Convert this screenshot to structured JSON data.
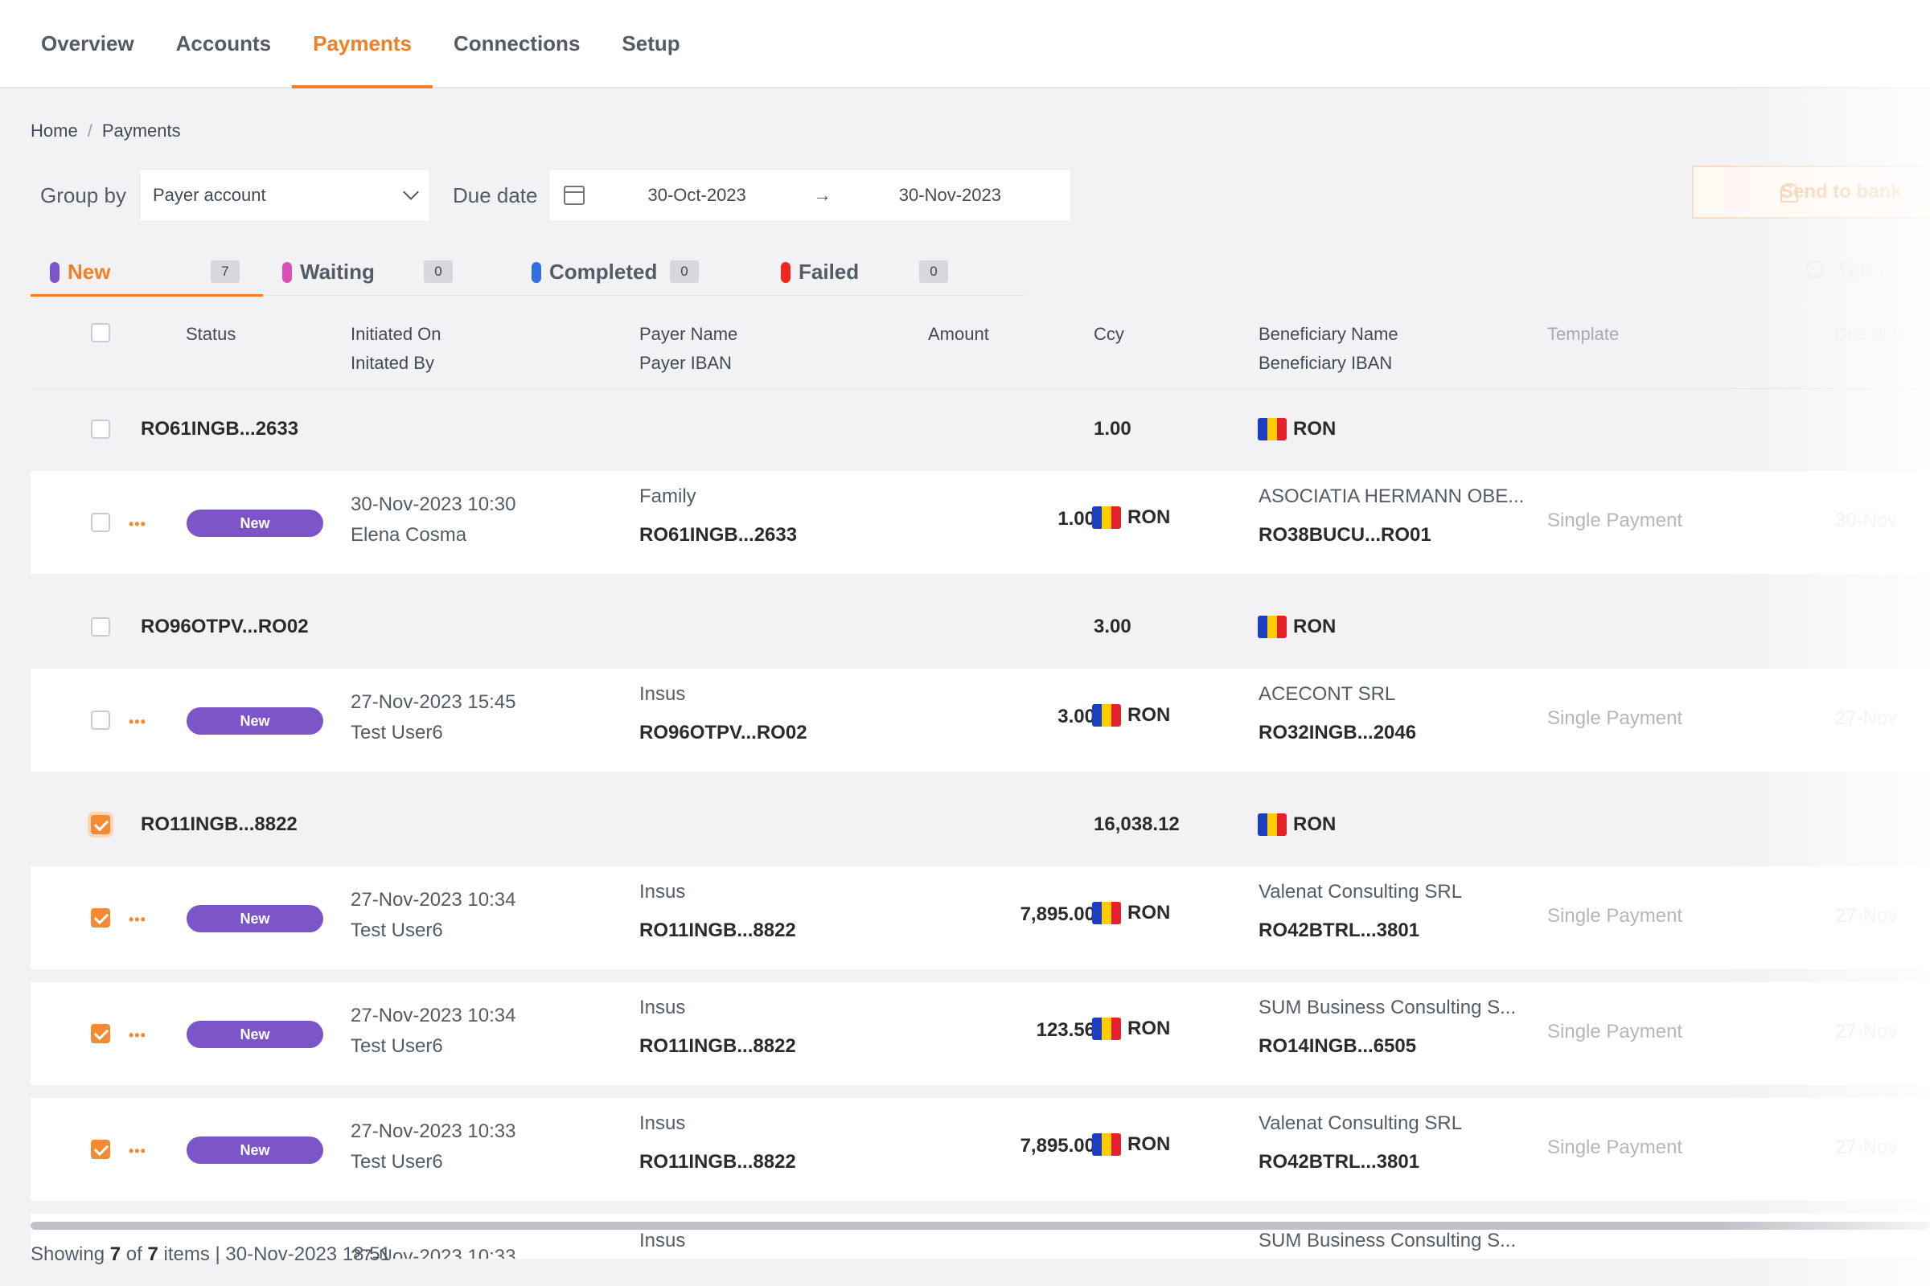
{
  "nav": {
    "tabs": [
      {
        "label": "Overview"
      },
      {
        "label": "Accounts"
      },
      {
        "label": "Payments"
      },
      {
        "label": "Connections"
      },
      {
        "label": "Setup"
      }
    ],
    "active": "Payments"
  },
  "breadcrumb": {
    "home": "Home",
    "sep": "/",
    "current": "Payments"
  },
  "filters": {
    "group_by_label": "Group by",
    "group_by_value": "Payer account",
    "due_date_label": "Due date",
    "date_from": "30-Oct-2023",
    "arrow": "→",
    "date_to": "30-Nov-2023"
  },
  "actions": {
    "send_label": "Send to bank"
  },
  "search": {
    "placeholder": "Type a"
  },
  "status_tabs": [
    {
      "label": "New",
      "count": "7",
      "color": "#7c55c9"
    },
    {
      "label": "Waiting",
      "count": "0",
      "color": "#d94fb2"
    },
    {
      "label": "Completed",
      "count": "0",
      "color": "#2f6fdf"
    },
    {
      "label": "Failed",
      "count": "0",
      "color": "#f0271c"
    }
  ],
  "table": {
    "headers": {
      "status": "Status",
      "initiated_on": "Initiated On",
      "initiated_by": "Initated By",
      "payer_name": "Payer Name",
      "payer_iban": "Payer IBAN",
      "amount": "Amount",
      "ccy": "Ccy",
      "beneficiary_name": "Beneficiary Name",
      "beneficiary_iban": "Beneficiary IBAN",
      "template": "Template",
      "due_date": "Due date"
    },
    "groups": [
      {
        "account": "RO61INGB...2633",
        "total": "1.00",
        "ccy": "RON",
        "checked": false,
        "rows": [
          {
            "status": "New",
            "initiated_on": "30-Nov-2023 10:30",
            "initiated_by": "Elena Cosma",
            "payer_name": "Family",
            "payer_iban": "RO61INGB...2633",
            "amount": "1.00",
            "ccy": "RON",
            "beneficiary_name": "ASOCIATIA HERMANN OBE...",
            "beneficiary_iban": "RO38BUCU...RO01",
            "template": "Single Payment",
            "due": "30-Nov",
            "checked": false
          }
        ]
      },
      {
        "account": "RO96OTPV...RO02",
        "total": "3.00",
        "ccy": "RON",
        "checked": false,
        "rows": [
          {
            "status": "New",
            "initiated_on": "27-Nov-2023 15:45",
            "initiated_by": "Test User6",
            "payer_name": "Insus",
            "payer_iban": "RO96OTPV...RO02",
            "amount": "3.00",
            "ccy": "RON",
            "beneficiary_name": "ACECONT SRL",
            "beneficiary_iban": "RO32INGB...2046",
            "template": "Single Payment",
            "due": "27-Nov",
            "checked": false
          }
        ]
      },
      {
        "account": "RO11INGB...8822",
        "total": "16,038.12",
        "ccy": "RON",
        "checked": true,
        "rows": [
          {
            "status": "New",
            "initiated_on": "27-Nov-2023 10:34",
            "initiated_by": "Test User6",
            "payer_name": "Insus",
            "payer_iban": "RO11INGB...8822",
            "amount": "7,895.00",
            "ccy": "RON",
            "beneficiary_name": "Valenat Consulting SRL",
            "beneficiary_iban": "RO42BTRL...3801",
            "template": "Single Payment",
            "due": "27-Nov",
            "checked": true
          },
          {
            "status": "New",
            "initiated_on": "27-Nov-2023 10:34",
            "initiated_by": "Test User6",
            "payer_name": "Insus",
            "payer_iban": "RO11INGB...8822",
            "amount": "123.56",
            "ccy": "RON",
            "beneficiary_name": "SUM Business Consulting S...",
            "beneficiary_iban": "RO14INGB...6505",
            "template": "Single Payment",
            "due": "27-Nov",
            "checked": true
          },
          {
            "status": "New",
            "initiated_on": "27-Nov-2023 10:33",
            "initiated_by": "Test User6",
            "payer_name": "Insus",
            "payer_iban": "RO11INGB...8822",
            "amount": "7,895.00",
            "ccy": "RON",
            "beneficiary_name": "Valenat Consulting SRL",
            "beneficiary_iban": "RO42BTRL...3801",
            "template": "Single Payment",
            "due": "27-Nov",
            "checked": true
          }
        ]
      }
    ],
    "partial_row": {
      "initiated_on": "27-Nov-2023 10:33",
      "payer_name": "Insus",
      "beneficiary_name": "SUM Business Consulting S..."
    }
  },
  "footer": {
    "prefix": "Showing",
    "shown": "7",
    "of": "of",
    "total": "7",
    "items": "items",
    "sep": "|",
    "timestamp": "30-Nov-2023 18:51"
  },
  "colors": {
    "accent": "#f07f25",
    "badge_new": "#7c55c9"
  }
}
